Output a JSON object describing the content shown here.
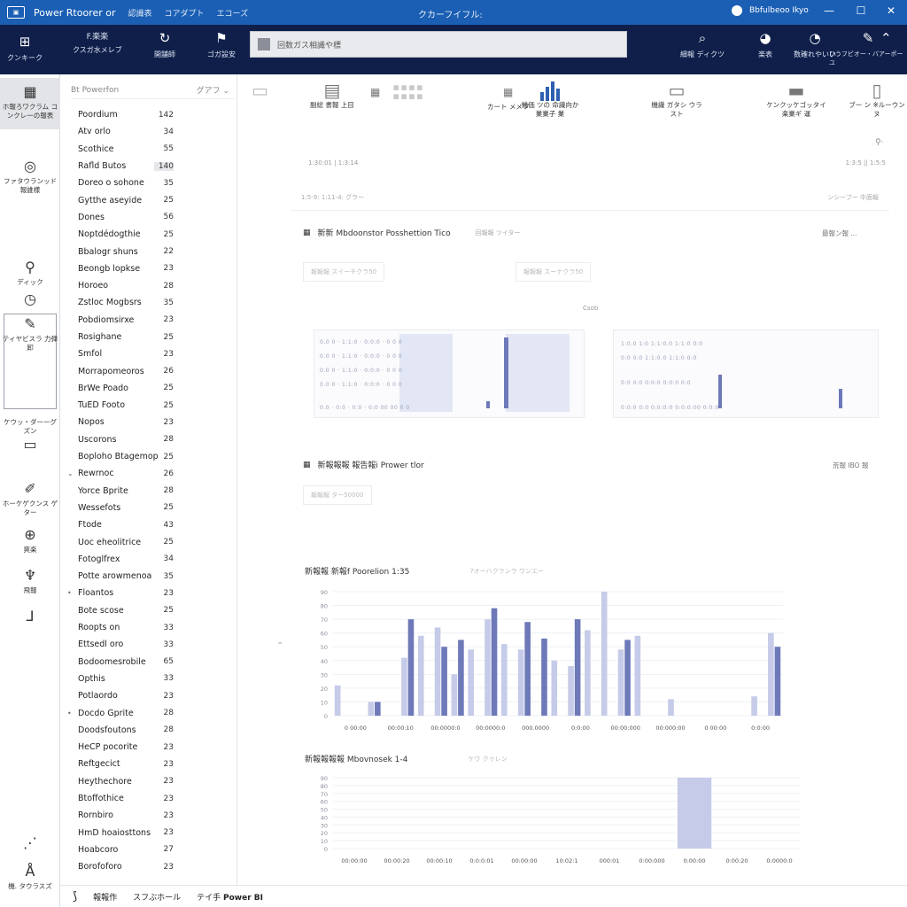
{
  "titlebar": {
    "app_name": "Power Rtoorer or",
    "menus": [
      "認識表",
      "コアダプト",
      "エコーズ"
    ],
    "window_title": "クカーフイフル:",
    "user": "Bbfulbeoo Ikyo",
    "minimize": "—",
    "maximize": "☐",
    "close": "✕"
  },
  "header": {
    "menu_label": "クンキーク",
    "buttons": [
      {
        "icon": "home-icon",
        "glyph": "⌂",
        "label": "クスガ水メレブ",
        "title": "F.楽楽"
      },
      {
        "icon": "refresh-icon",
        "glyph": "↻",
        "label": "開舗師"
      },
      {
        "icon": "flag-icon",
        "glyph": "⚑",
        "label": "ゴガ設安"
      }
    ],
    "search_placeholder": "回数ガス相識や標",
    "right_buttons": [
      {
        "icon": "search-icon",
        "glyph": "⌕",
        "label": "細報 ディクツ"
      },
      {
        "icon": "globe-icon",
        "glyph": "◕",
        "label": "楽表"
      },
      {
        "icon": "pin-icon",
        "glyph": "◔",
        "label": "数確れやいい"
      },
      {
        "icon": "chat-icon",
        "glyph": "✎",
        "label": "ひうフビオー・バアーポーユ"
      },
      {
        "icon": "share-icon",
        "glyph": "⌃",
        "label": ""
      }
    ]
  },
  "rail": {
    "items": [
      {
        "icon": "report-icon",
        "glyph": "▦",
        "label": "ホ報ろワクラム コンクレーの報表"
      },
      {
        "icon": "target-icon",
        "glyph": "◎",
        "label": "ファタウランッド 報誰様"
      },
      {
        "icon": "user-icon",
        "glyph": "⚲",
        "label": "ディック"
      },
      {
        "icon": "clock-icon",
        "glyph": "◷",
        "label": ""
      },
      {
        "icon": "pen-icon",
        "glyph": "✎",
        "label": "ティヤビスラ 力弾卸"
      },
      {
        "icon": "card-icon",
        "glyph": "▭",
        "label": "ケウッ・ダーーグ ズン"
      },
      {
        "icon": "brush-icon",
        "glyph": "✐",
        "label": "ホーケゲクンス ゲター"
      },
      {
        "icon": "search-globe-icon",
        "glyph": "⊕",
        "label": "爽楽"
      },
      {
        "icon": "gift-icon",
        "glyph": "♆",
        "label": "飛報"
      },
      {
        "icon": "step-icon",
        "glyph": "⅃",
        "label": ""
      },
      {
        "icon": "dots-icon",
        "glyph": "⋰",
        "label": ""
      },
      {
        "icon": "account-icon",
        "glyph": "Å",
        "label": "機. タウラスズ"
      }
    ]
  },
  "fields": {
    "search_placeholder": "Bt Powerfon",
    "filter_label": "グアフ",
    "items": [
      {
        "name": "Poordium",
        "count": "142"
      },
      {
        "name": "Atv orlo",
        "count": "34"
      },
      {
        "name": "Scothice",
        "count": "55"
      },
      {
        "name": "Rafld Butos",
        "count": "140",
        "selected": true
      },
      {
        "name": "Doreo o sohone",
        "count": "35"
      },
      {
        "name": "Gytthe aseyide",
        "count": "25"
      },
      {
        "name": "Dones",
        "count": "56"
      },
      {
        "name": "Noptdédogthie",
        "count": "25"
      },
      {
        "name": "Bbalogr shuns",
        "count": "22"
      },
      {
        "name": "Beongb lopkse",
        "count": "23"
      },
      {
        "name": "Horoeo",
        "count": "28"
      },
      {
        "name": "Zstloc Mogbsrs",
        "count": "35"
      },
      {
        "name": "Pobdiomsirxe",
        "count": "23"
      },
      {
        "name": "Rosighane",
        "count": "25"
      },
      {
        "name": "Smfol",
        "count": "23"
      },
      {
        "name": "Morrapomeoros",
        "count": "26"
      },
      {
        "name": "BrWe Poado",
        "count": "25"
      },
      {
        "name": "TuED Footo",
        "count": "25"
      },
      {
        "name": "Nopos",
        "count": "23"
      },
      {
        "name": "Uscorons",
        "count": "28"
      },
      {
        "name": "Boploho Btagemop",
        "count": "25"
      },
      {
        "name": "Rewrnoc",
        "count": "26",
        "mark": "⌄"
      },
      {
        "name": "Yorce Bprite",
        "count": "28"
      },
      {
        "name": "Wessefots",
        "count": "25"
      },
      {
        "name": "Ftode",
        "count": "43"
      },
      {
        "name": "Uoc eheolitrice",
        "count": "25"
      },
      {
        "name": "Fotoglfrex",
        "count": "34"
      },
      {
        "name": "Potte arowmenoa",
        "count": "35"
      },
      {
        "name": "Floantos",
        "count": "23",
        "mark": "•"
      },
      {
        "name": "Bote scose",
        "count": "25"
      },
      {
        "name": "Roopts on",
        "count": "33"
      },
      {
        "name": "Ettsedl oro",
        "count": "33"
      },
      {
        "name": "Bodoomesrobile",
        "count": "65"
      },
      {
        "name": "Opthis",
        "count": "33"
      },
      {
        "name": "Potlaordo",
        "count": "23"
      },
      {
        "name": "Docdo Gprite",
        "count": "28",
        "mark": "•"
      },
      {
        "name": "Doodsfoutons",
        "count": "28"
      },
      {
        "name": "HeCP pocorite",
        "count": "23"
      },
      {
        "name": "Reftgecict",
        "count": "23"
      },
      {
        "name": "Heythechore",
        "count": "23"
      },
      {
        "name": "Btoffothice",
        "count": "23"
      },
      {
        "name": "Rornbiro",
        "count": "23"
      },
      {
        "name": "HmD hoaiosttons",
        "count": "23"
      },
      {
        "name": "Hoabcoro",
        "count": "27"
      },
      {
        "name": "Borofoforo",
        "count": "23"
      }
    ]
  },
  "ribbon": {
    "buttons": [
      {
        "label": "副総 書報 上目",
        "icon": "page-icon",
        "glyph": "▤"
      },
      {
        "label": "カート メメツ",
        "icon": "table-icon",
        "glyph": "▦"
      },
      {
        "label": "機価 ツの 命識向か 業業子 業",
        "icon": "column-chart-icon"
      },
      {
        "label": "機識 ガタシ ウラスト",
        "icon": "doc-icon",
        "glyph": "▭"
      },
      {
        "label": "ケンクッケゴッタイ 楽業ギ 運",
        "icon": "window-icon",
        "glyph": "▬"
      },
      {
        "label": "ブー ン ※ルーウンヌ",
        "icon": "export-icon",
        "glyph": "▯"
      }
    ]
  },
  "canvas": {
    "crumbs_left": "1:30:01  |  1:3:14",
    "crumbs_right": "1:3:5 || 1:5:5",
    "filter_left": "1:5-9:  1:11-4: グラー",
    "filter_right": "ンシーブー 中面報",
    "section1": {
      "title": "新新 Mbdoonstor Posshettion Tico",
      "subtitle": "回報報 ツイター",
      "right": "最報ン報  ...",
      "chip1": "報報報 スイーチクラ50",
      "chip2": "報報報 スーナクラ50",
      "center_label": "Csob"
    },
    "section2": {
      "title": "新報報報 報告報i Prower tlor",
      "right": "荒報 IBO 報",
      "chip": "報報報 ター50000"
    },
    "chart1": {
      "title": "新報報 新報f Poorelion 1:35",
      "subtitle": "7オーハクランラ ワンエー"
    },
    "chart2": {
      "title": "新報報報報 Mbovnosek 1-4",
      "subtitle": "ケウ クゥレン"
    }
  },
  "chart_data": [
    {
      "type": "bar",
      "title": "新報報 新報f Poorelion 1:35",
      "ylim": [
        0,
        90
      ],
      "yticks": [
        "90",
        "80",
        "70",
        "60",
        "50",
        "40",
        "30",
        "20",
        "10",
        "0"
      ],
      "xticks": [
        "0 00:00",
        "00:00:10",
        "00:0000:0",
        "00:0000:0",
        "000.0000",
        "0:0:00",
        "00:00:000",
        "00:000:00",
        "0 00:00",
        "0:0:00"
      ],
      "series": [
        {
          "values": [
            22,
            0,
            10,
            0,
            42,
            58,
            64,
            30,
            48,
            70,
            52,
            48,
            0,
            40,
            36,
            62,
            100,
            48,
            58,
            0,
            12,
            0,
            0,
            0,
            0,
            14,
            60
          ]
        },
        {
          "values": [
            0,
            0,
            10,
            0,
            70,
            0,
            50,
            55,
            0,
            78,
            0,
            68,
            56,
            0,
            70,
            0,
            0,
            55,
            0,
            0,
            0,
            0,
            0,
            0,
            0,
            0,
            50
          ]
        }
      ]
    },
    {
      "type": "bar",
      "title": "新報報報報 Mbovnosek 1-4",
      "ylim": [
        0,
        90
      ],
      "yticks": [
        "90",
        "80",
        "70",
        "60",
        "50",
        "40",
        "30",
        "20",
        "10",
        "0"
      ],
      "xticks": [
        "00:00:00",
        "00:00:20",
        "00:00:10",
        "0:0:0:01",
        "00:00:00",
        "10:02:1",
        "000:01",
        "0:00:000",
        "0:00:00",
        "0:00:20",
        "0:0000:0"
      ],
      "series": [
        {
          "values": [
            0,
            0,
            0,
            0,
            0,
            0,
            0,
            0,
            90,
            0,
            0
          ]
        }
      ]
    }
  ],
  "statusbar": {
    "logo_glyph": "⟆",
    "item1": "報報作",
    "item2": "スフぶホール",
    "item3_prefix": "テイ手",
    "item3_product": "Power BI"
  },
  "colors": {
    "titlebar": "#1a5fb4",
    "header": "#0f1f4a",
    "bar_dark": "#6d79b8",
    "bar_light": "#c5cbe8"
  }
}
